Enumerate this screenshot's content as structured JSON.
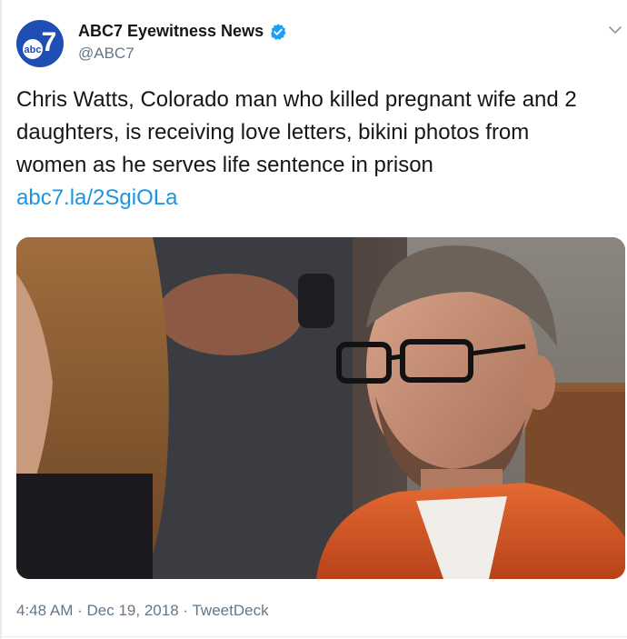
{
  "account": {
    "name": "ABC7 Eyewitness News",
    "handle": "@ABC7",
    "logo_text": "abc",
    "logo_number": "7",
    "verified": true
  },
  "tweet": {
    "text_lines": [
      "Chris Watts, Colorado man who killed pregnant wife and 2",
      "daughters, is receiving love letters, bikini photos from",
      "women as he serves life sentence in prison"
    ],
    "link": "abc7.la/2SgiOLa"
  },
  "meta": {
    "time": "4:48 AM",
    "separator": "·",
    "date": "Dec 19, 2018",
    "source": "TweetDeck"
  },
  "colors": {
    "link": "#1b95e0",
    "secondary_text": "#657786",
    "verified_badge": "#1da1f2",
    "logo": "#1f4fb5"
  },
  "icons": {
    "verified": "verified-badge-icon",
    "menu": "chevron-down-icon"
  }
}
